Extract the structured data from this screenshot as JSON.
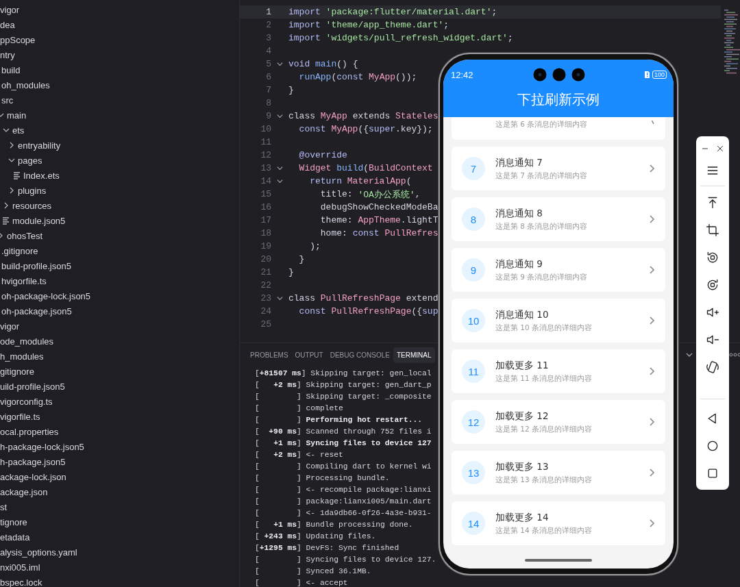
{
  "sidebar": {
    "tree": [
      {
        "label": "vigor"
      },
      {
        "label": "dea"
      },
      {
        "label": "ppScope"
      },
      {
        "label": "ntry",
        "children": [
          {
            "label": "build"
          },
          {
            "label": "oh_modules"
          },
          {
            "label": "src",
            "children": [
              {
                "label": "main",
                "kind": "folder",
                "expanded": true,
                "children": [
                  {
                    "label": "ets",
                    "kind": "folder",
                    "expanded": true,
                    "children": [
                      {
                        "label": "entryability",
                        "kind": "folder",
                        "expanded": false
                      },
                      {
                        "label": "pages",
                        "kind": "folder",
                        "expanded": true,
                        "children": [
                          {
                            "label": "Index.ets",
                            "kind": "file"
                          }
                        ]
                      },
                      {
                        "label": "plugins",
                        "kind": "folder",
                        "expanded": false
                      }
                    ]
                  },
                  {
                    "label": "resources",
                    "kind": "folder",
                    "expanded": false
                  },
                  {
                    "label": "module.json5",
                    "kind": "file"
                  }
                ]
              },
              {
                "label": "ohosTest",
                "kind": "folder",
                "expanded": false
              }
            ]
          },
          {
            "label": ".gitignore"
          },
          {
            "label": "build-profile.json5"
          },
          {
            "label": "hvigorfile.ts"
          },
          {
            "label": "oh-package-lock.json5"
          },
          {
            "label": "oh-package.json5"
          }
        ]
      },
      {
        "label": "vigor"
      },
      {
        "label": "ode_modules"
      },
      {
        "label": "h_modules"
      },
      {
        "label": "gitignore"
      },
      {
        "label": "uild-profile.json5"
      },
      {
        "label": "vigorconfig.ts"
      },
      {
        "label": "vigorfile.ts"
      },
      {
        "label": "ocal.properties"
      },
      {
        "label": "h-package-lock.json5"
      },
      {
        "label": "h-package.json5"
      },
      {
        "label": "ackage-lock.json"
      },
      {
        "label": "ackage.json"
      },
      {
        "label": "st"
      },
      {
        "label": "tignore"
      },
      {
        "label": "etadata"
      },
      {
        "label": "alysis_options.yaml"
      },
      {
        "label": "nxi005.iml"
      },
      {
        "label": "bspec.lock"
      }
    ]
  },
  "editor": {
    "lines": [
      {
        "number": "1",
        "foldable": false,
        "current": true,
        "tokens": [
          {
            "text": "import",
            "kind": "keyword"
          },
          {
            "text": " 'package:flutter/material.dart'",
            "kind": "string"
          },
          {
            "text": ";",
            "kind": "plain"
          }
        ]
      },
      {
        "number": "2",
        "foldable": false,
        "current": false,
        "tokens": [
          {
            "text": "import",
            "kind": "keyword"
          },
          {
            "text": " 'theme/app_theme.dart'",
            "kind": "string"
          },
          {
            "text": ";",
            "kind": "plain"
          }
        ]
      },
      {
        "number": "3",
        "foldable": false,
        "current": false,
        "tokens": [
          {
            "text": "import",
            "kind": "keyword"
          },
          {
            "text": " 'widgets/pull_refresh_widget.dart'",
            "kind": "string"
          },
          {
            "text": ";",
            "kind": "plain"
          }
        ]
      },
      {
        "number": "4",
        "foldable": false,
        "current": false
      },
      {
        "number": "5",
        "foldable": true,
        "current": false,
        "tokens": [
          {
            "text": "void",
            "kind": "keyword"
          },
          {
            "text": " main",
            "kind": "function"
          },
          {
            "text": "() {",
            "kind": "plain"
          }
        ]
      },
      {
        "number": "6",
        "foldable": false,
        "current": false,
        "tokens": [
          {
            "text": "  runApp",
            "kind": "function"
          },
          {
            "text": "(",
            "kind": "plain"
          },
          {
            "text": "const",
            "kind": "keyword"
          },
          {
            "text": " MyApp",
            "kind": "type"
          },
          {
            "text": "());",
            "kind": "plain"
          }
        ]
      },
      {
        "number": "7",
        "foldable": false,
        "current": false,
        "tokens": [
          {
            "text": "}",
            "kind": "plain"
          }
        ]
      },
      {
        "number": "8",
        "foldable": false,
        "current": false
      },
      {
        "number": "9",
        "foldable": true,
        "current": false,
        "tokens": [
          {
            "text": "class ",
            "kind": "plain"
          },
          {
            "text": "MyApp",
            "kind": "type"
          },
          {
            "text": " extends ",
            "kind": "plain"
          },
          {
            "text": "Stateles",
            "kind": "type"
          }
        ]
      },
      {
        "number": "10",
        "foldable": false,
        "current": false,
        "tokens": [
          {
            "text": "  const",
            "kind": "keyword"
          },
          {
            "text": " MyApp",
            "kind": "type"
          },
          {
            "text": "({",
            "kind": "plain"
          },
          {
            "text": "super",
            "kind": "keyword"
          },
          {
            "text": ".key});",
            "kind": "plain"
          }
        ]
      },
      {
        "number": "11",
        "foldable": false,
        "current": false
      },
      {
        "number": "12",
        "foldable": false,
        "current": false,
        "tokens": [
          {
            "text": "  @override",
            "kind": "keyword"
          }
        ]
      },
      {
        "number": "13",
        "foldable": true,
        "current": false,
        "tokens": [
          {
            "text": "  Widget",
            "kind": "type"
          },
          {
            "text": " build",
            "kind": "function"
          },
          {
            "text": "(",
            "kind": "plain"
          },
          {
            "text": "BuildContext",
            "kind": "type"
          }
        ]
      },
      {
        "number": "14",
        "foldable": true,
        "current": false,
        "tokens": [
          {
            "text": "    return",
            "kind": "keyword"
          },
          {
            "text": " MaterialApp",
            "kind": "type"
          },
          {
            "text": "(",
            "kind": "plain"
          }
        ]
      },
      {
        "number": "15",
        "foldable": false,
        "current": false,
        "tokens": [
          {
            "text": "      title: ",
            "kind": "plain"
          },
          {
            "text": "'OA办公系统'",
            "kind": "string"
          },
          {
            "text": ",",
            "kind": "plain"
          }
        ]
      },
      {
        "number": "16",
        "foldable": false,
        "current": false,
        "tokens": [
          {
            "text": "      debugShowCheckedModeBa",
            "kind": "plain"
          }
        ]
      },
      {
        "number": "17",
        "foldable": false,
        "current": false,
        "tokens": [
          {
            "text": "      theme: ",
            "kind": "plain"
          },
          {
            "text": "AppTheme",
            "kind": "type"
          },
          {
            "text": ".lightT",
            "kind": "plain"
          }
        ]
      },
      {
        "number": "18",
        "foldable": false,
        "current": false,
        "tokens": [
          {
            "text": "      home: ",
            "kind": "plain"
          },
          {
            "text": "const",
            "kind": "keyword"
          },
          {
            "text": " PullRefres",
            "kind": "type"
          }
        ]
      },
      {
        "number": "19",
        "foldable": false,
        "current": false,
        "tokens": [
          {
            "text": "    );",
            "kind": "plain"
          }
        ]
      },
      {
        "number": "20",
        "foldable": false,
        "current": false,
        "tokens": [
          {
            "text": "  }",
            "kind": "plain"
          }
        ]
      },
      {
        "number": "21",
        "foldable": false,
        "current": false,
        "tokens": [
          {
            "text": "}",
            "kind": "plain"
          }
        ]
      },
      {
        "number": "22",
        "foldable": false,
        "current": false
      },
      {
        "number": "23",
        "foldable": true,
        "current": false,
        "tokens": [
          {
            "text": "class ",
            "kind": "plain"
          },
          {
            "text": "PullRefreshPage",
            "kind": "type"
          },
          {
            "text": " extend",
            "kind": "plain"
          }
        ]
      },
      {
        "number": "24",
        "foldable": false,
        "current": false,
        "tokens": [
          {
            "text": "  const",
            "kind": "keyword"
          },
          {
            "text": " PullRefreshPage",
            "kind": "type"
          },
          {
            "text": "({",
            "kind": "plain"
          },
          {
            "text": "sup",
            "kind": "keyword"
          }
        ]
      },
      {
        "number": "25",
        "foldable": false,
        "current": false
      }
    ]
  },
  "panel": {
    "tabs": [
      {
        "label": "PROBLEMS",
        "selected": false
      },
      {
        "label": "OUTPUT",
        "selected": false
      },
      {
        "label": "DEBUG CONSOLE",
        "selected": false
      },
      {
        "label": "TERMINAL",
        "selected": true
      }
    ],
    "terminal_lines": [
      "[**+81507 ms**] Skipping target: gen_local",
      "[   **+2 ms**] Skipping target: gen_dart_p",
      "[        ] Skipping target: _composite",
      "[        ] complete",
      "[        ] **Performing hot restart...**",
      "[  **+90 ms**] Scanned through 752 files i",
      "[   **+1 ms**] **Syncing files to device 127**",
      "[   **+2 ms**] <- reset",
      "[        ] Compiling dart to kernel wi",
      "[        ] Processing bundle.",
      "[        ] <- recompile package:lianxi",
      "[        ] package:lianxi005/main.dart",
      "[        ] <- 1da9db66-0f26-4a3e-b931-",
      "[   **+1 ms**] Bundle processing done.",
      "[ **+243 ms**] Updating files.",
      "[**+1295 ms**] DevFS: Sync finished",
      "[        ] Syncing files to device 127.",
      "[        ] Synced 36.1MB.",
      "[        ] <- accept"
    ]
  },
  "phone": {
    "status_bar": {
      "time": "12:42",
      "battery": "100"
    },
    "app_bar": {
      "title": "下拉刷新示例"
    },
    "messages": [
      {
        "subtitle": "这是第 6 条消息的详细内容"
      },
      {
        "number": "7",
        "title": "消息通知 7",
        "subtitle": "这是第 7 条消息的详细内容"
      },
      {
        "number": "8",
        "title": "消息通知 8",
        "subtitle": "这是第 8 条消息的详细内容"
      },
      {
        "number": "9",
        "title": "消息通知 9",
        "subtitle": "这是第 9 条消息的详细内容"
      },
      {
        "number": "10",
        "title": "消息通知 10",
        "subtitle": "这是第 10 条消息的详细内容"
      },
      {
        "number": "11",
        "title": "加载更多 11",
        "subtitle": "这是第 11 条消息的详细内容"
      },
      {
        "number": "12",
        "title": "加载更多 12",
        "subtitle": "这是第 12 条消息的详细内容"
      },
      {
        "number": "13",
        "title": "加载更多 13",
        "subtitle": "这是第 13 条消息的详细内容"
      },
      {
        "number": "14",
        "title": "加载更多 14",
        "subtitle": "这是第 14 条消息的详细内容"
      }
    ]
  }
}
